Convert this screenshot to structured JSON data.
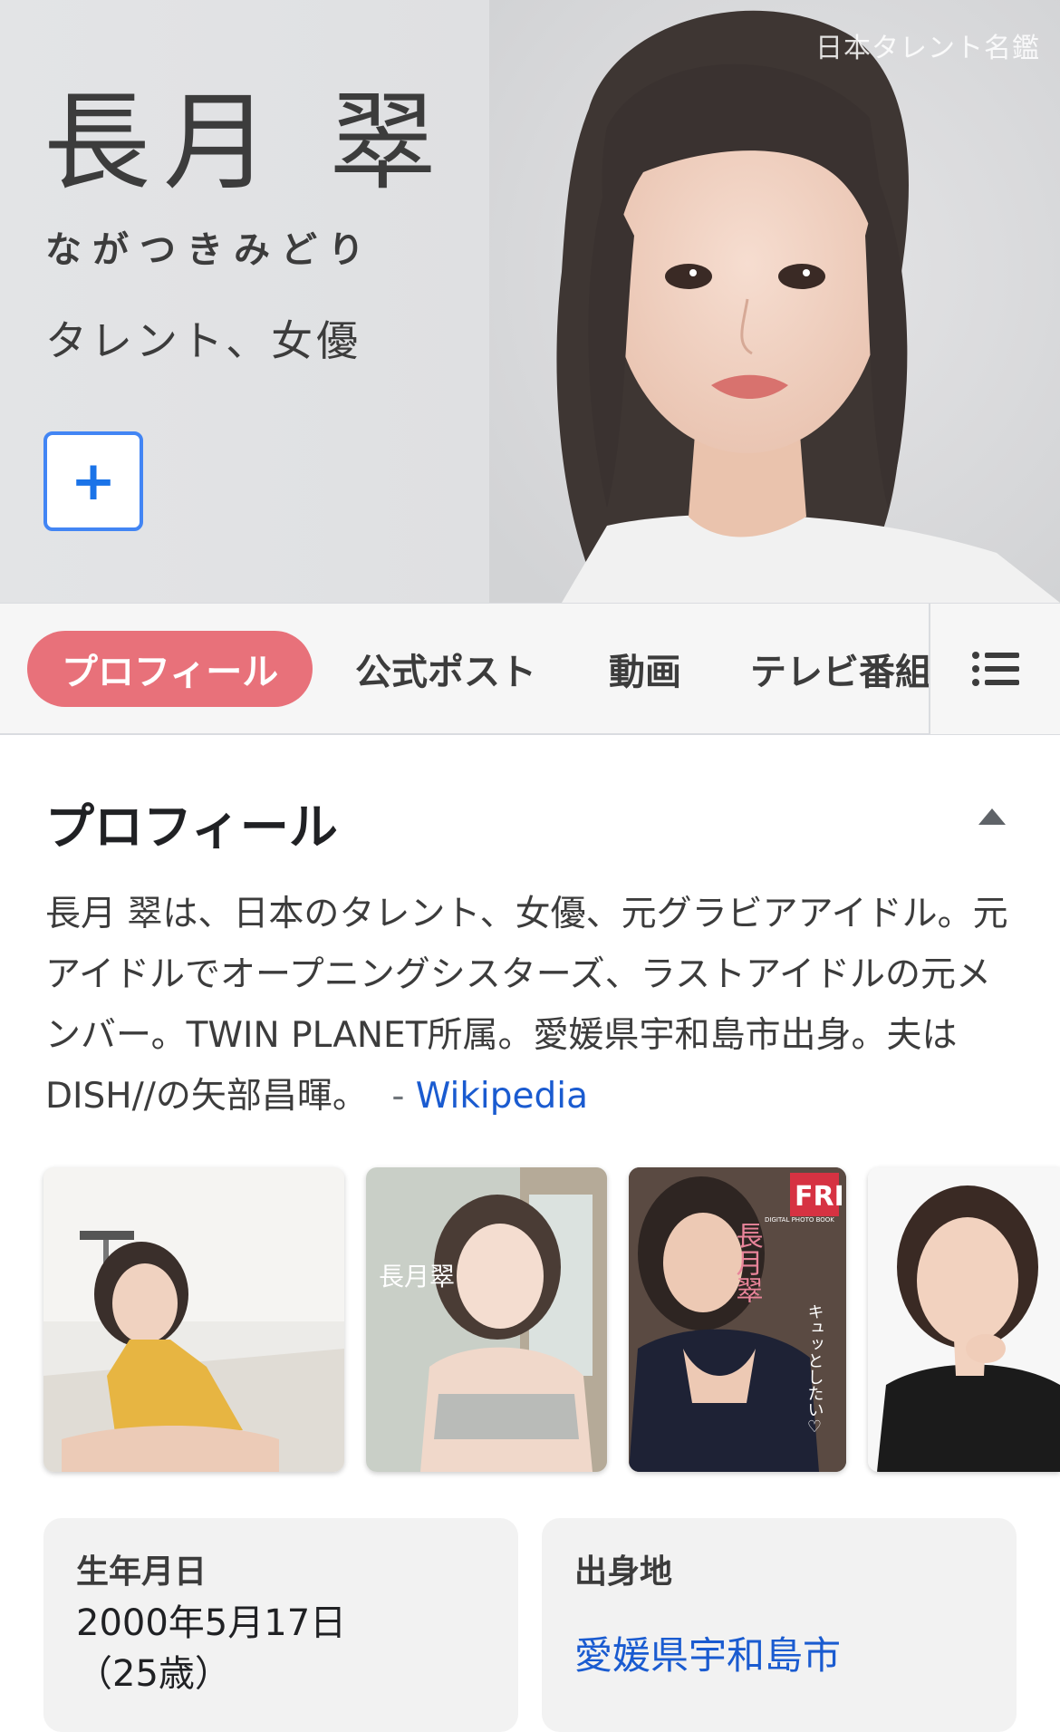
{
  "hero": {
    "name": "長月 翠",
    "kana": "ながつきみどり",
    "occupation": "タレント、女優",
    "watermark": "日本タレント名鑑",
    "add_button_label": "+"
  },
  "tabs": [
    {
      "label": "プロフィール",
      "active": true
    },
    {
      "label": "公式ポスト",
      "active": false
    },
    {
      "label": "動画",
      "active": false
    },
    {
      "label": "テレビ番組",
      "active": false
    }
  ],
  "profile": {
    "title": "プロフィール",
    "description": "長月 翠は、日本のタレント、女優、元グラビアアイドル。元アイドルでオープニングシスターズ、ラストアイドルの元メンバー。TWIN PLANET所属。愛媛県宇和島市出身。夫はDISH//の矢部昌暉。",
    "source_dash": "-",
    "source": "Wikipedia"
  },
  "thumbnails": {
    "book_cover_title": "長月翠",
    "fri_logo": "FRI",
    "fri_sub": "DIGITAL PHOTO BOOK",
    "fri_tagline": "キュッとしたい♡"
  },
  "info": {
    "birthday_label": "生年月日",
    "birthday_value": "2000年5月17日",
    "age": "（25歳）",
    "birthplace_label": "出身地",
    "birthplace_value": "愛媛県宇和島市"
  },
  "colors": {
    "accent_tab": "#e8717a",
    "link": "#1a5bd0",
    "add_border": "#4285f4"
  }
}
